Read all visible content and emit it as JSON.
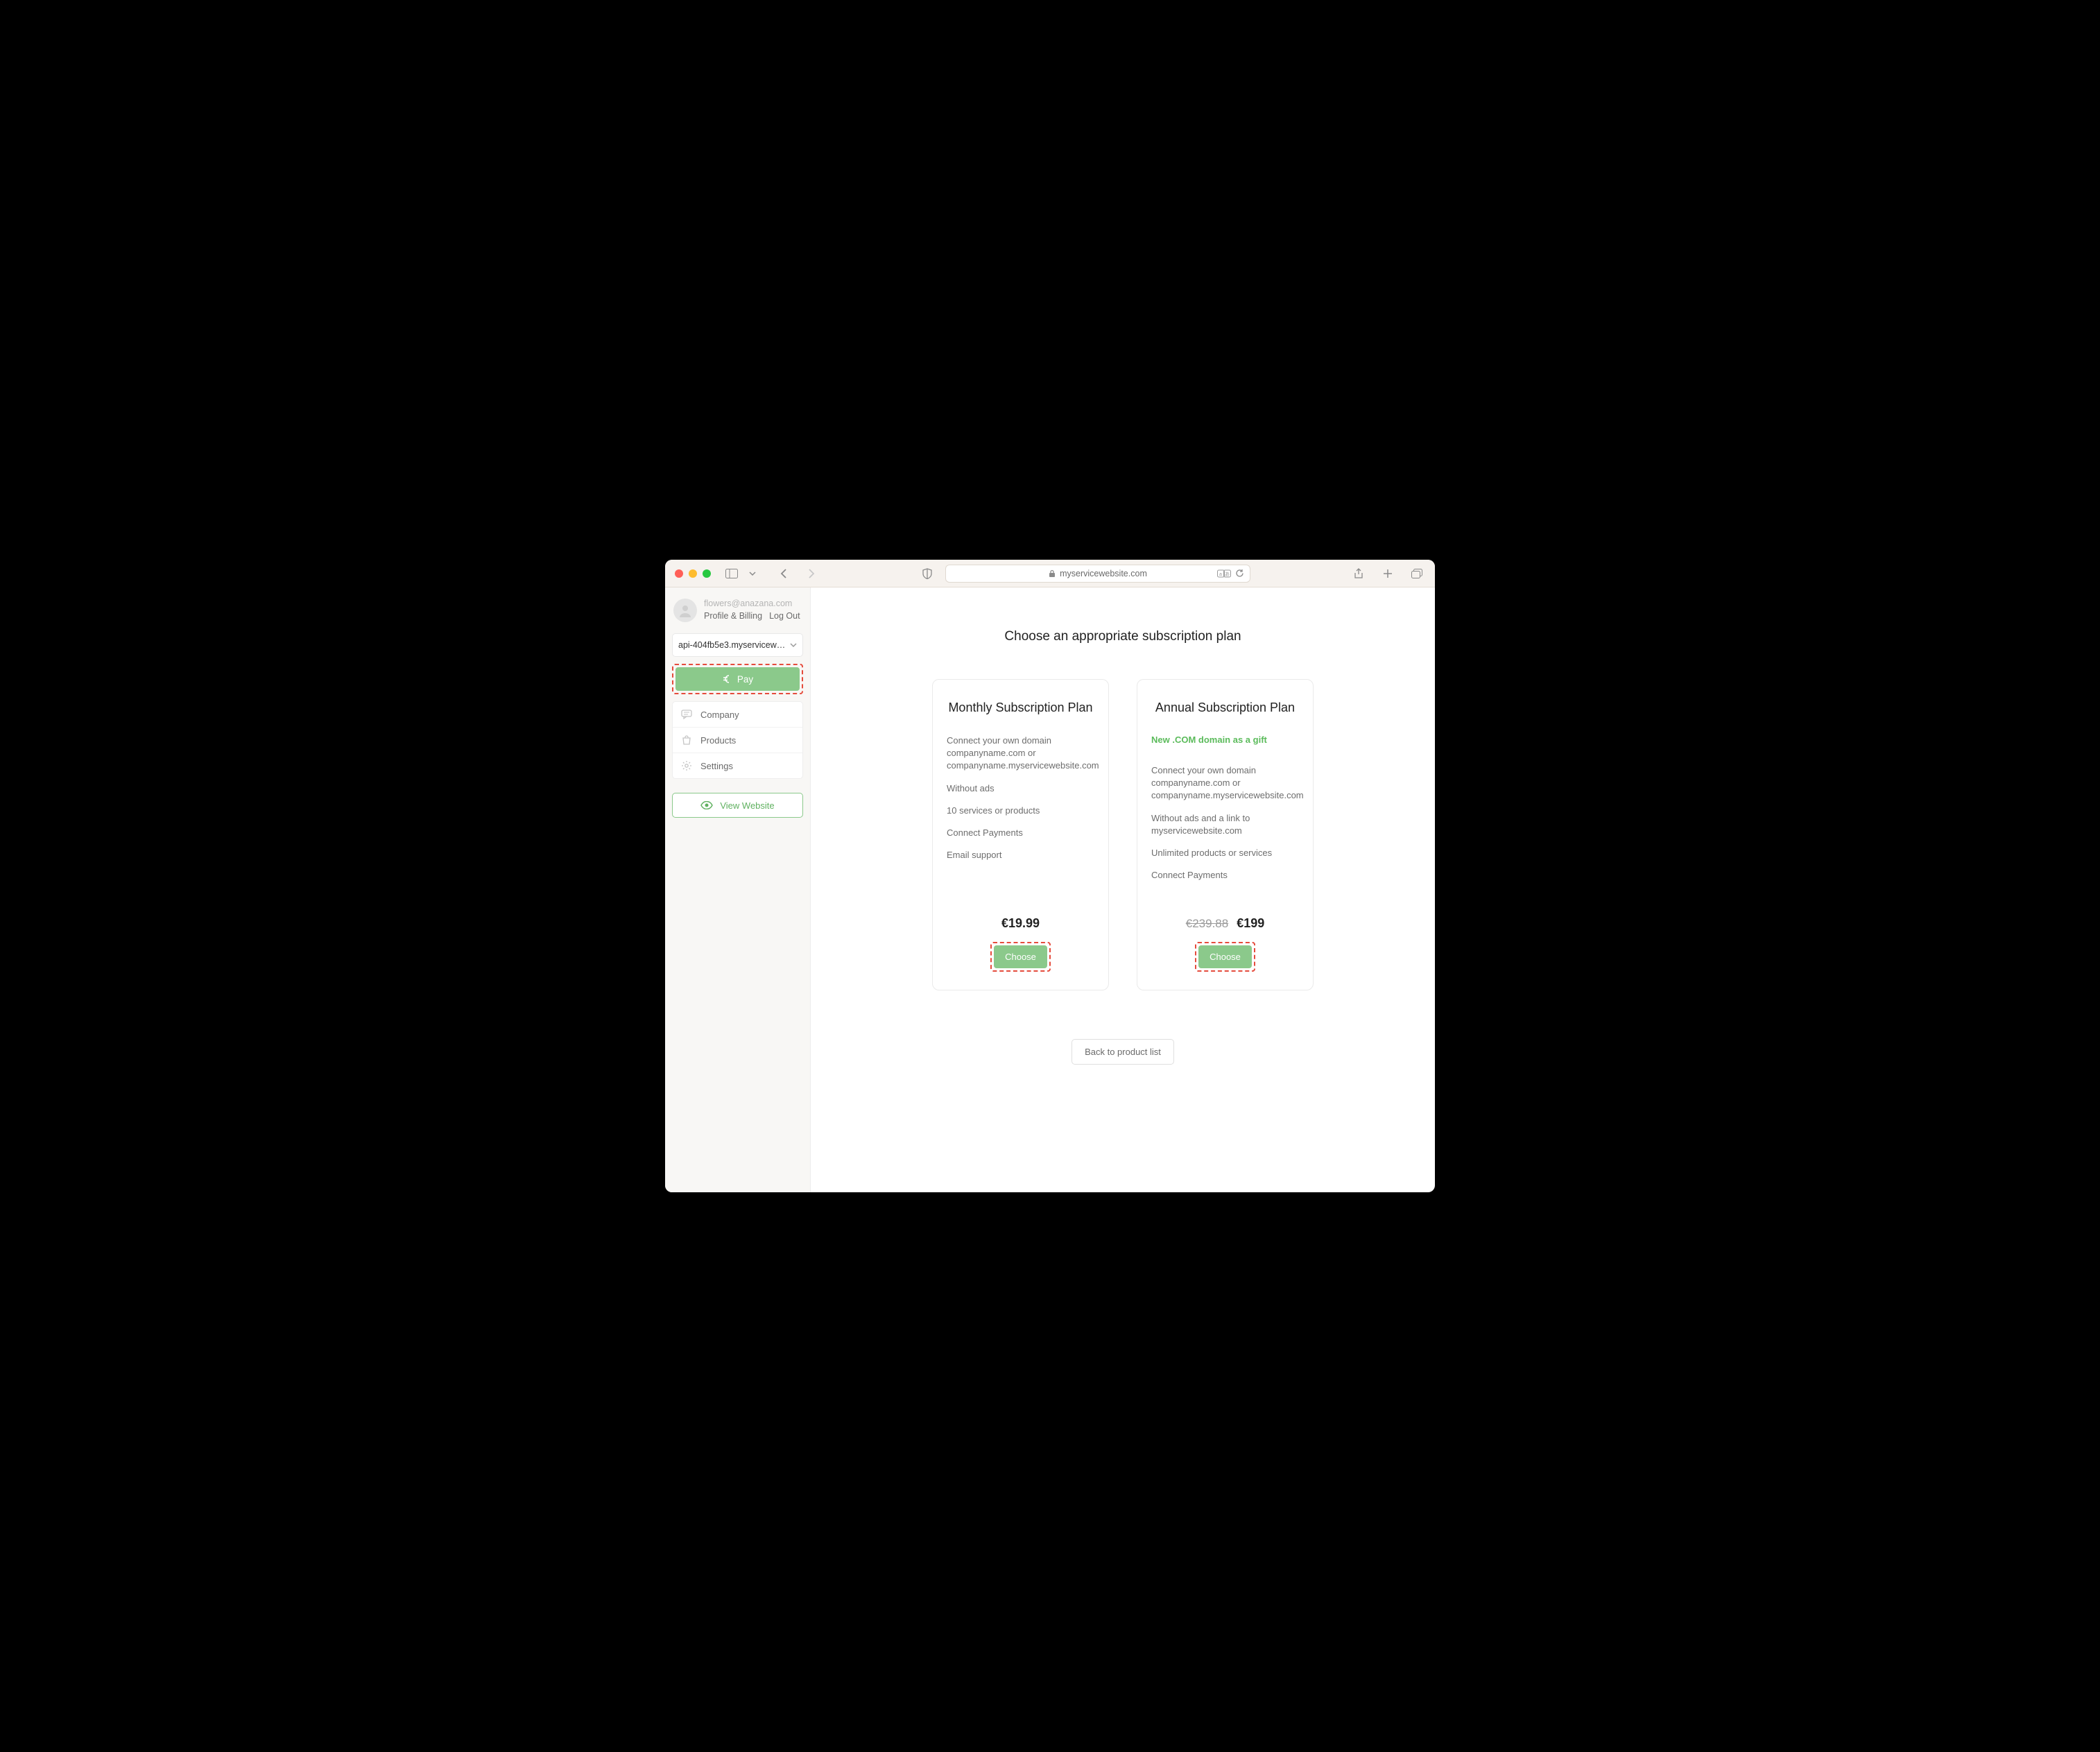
{
  "browser": {
    "url_host": "myservicewebsite.com"
  },
  "sidebar": {
    "user_email": "flowers@anazana.com",
    "profile_link": "Profile & Billing",
    "logout_link": "Log Out",
    "site_selector": "api-404fb5e3.myservicewebsite…",
    "pay_label": "Pay",
    "nav": {
      "company": "Company",
      "products": "Products",
      "settings": "Settings"
    },
    "view_website": "View Website"
  },
  "main": {
    "title": "Choose an appropriate subscription plan",
    "back_button": "Back to product list"
  },
  "plans": {
    "monthly": {
      "title": "Monthly Subscription Plan",
      "features": {
        "f1": "Connect your own domain companyname.com or companyname.myservicewebsite.com",
        "f2": "Without ads",
        "f3": "10 services or products",
        "f4": "Connect Payments",
        "f5": "Email support"
      },
      "price": "€19.99",
      "choose": "Choose"
    },
    "annual": {
      "title": "Annual Subscription Plan",
      "gift": "New .COM domain as a gift",
      "features": {
        "f1": "Connect your own domain companyname.com or companyname.myservicewebsite.com",
        "f2": "Without ads and a link to myservicewebsite.com",
        "f3": "Unlimited products or services",
        "f4": "Connect Payments"
      },
      "price_old": "€239.88",
      "price": "€199",
      "choose": "Choose"
    }
  }
}
